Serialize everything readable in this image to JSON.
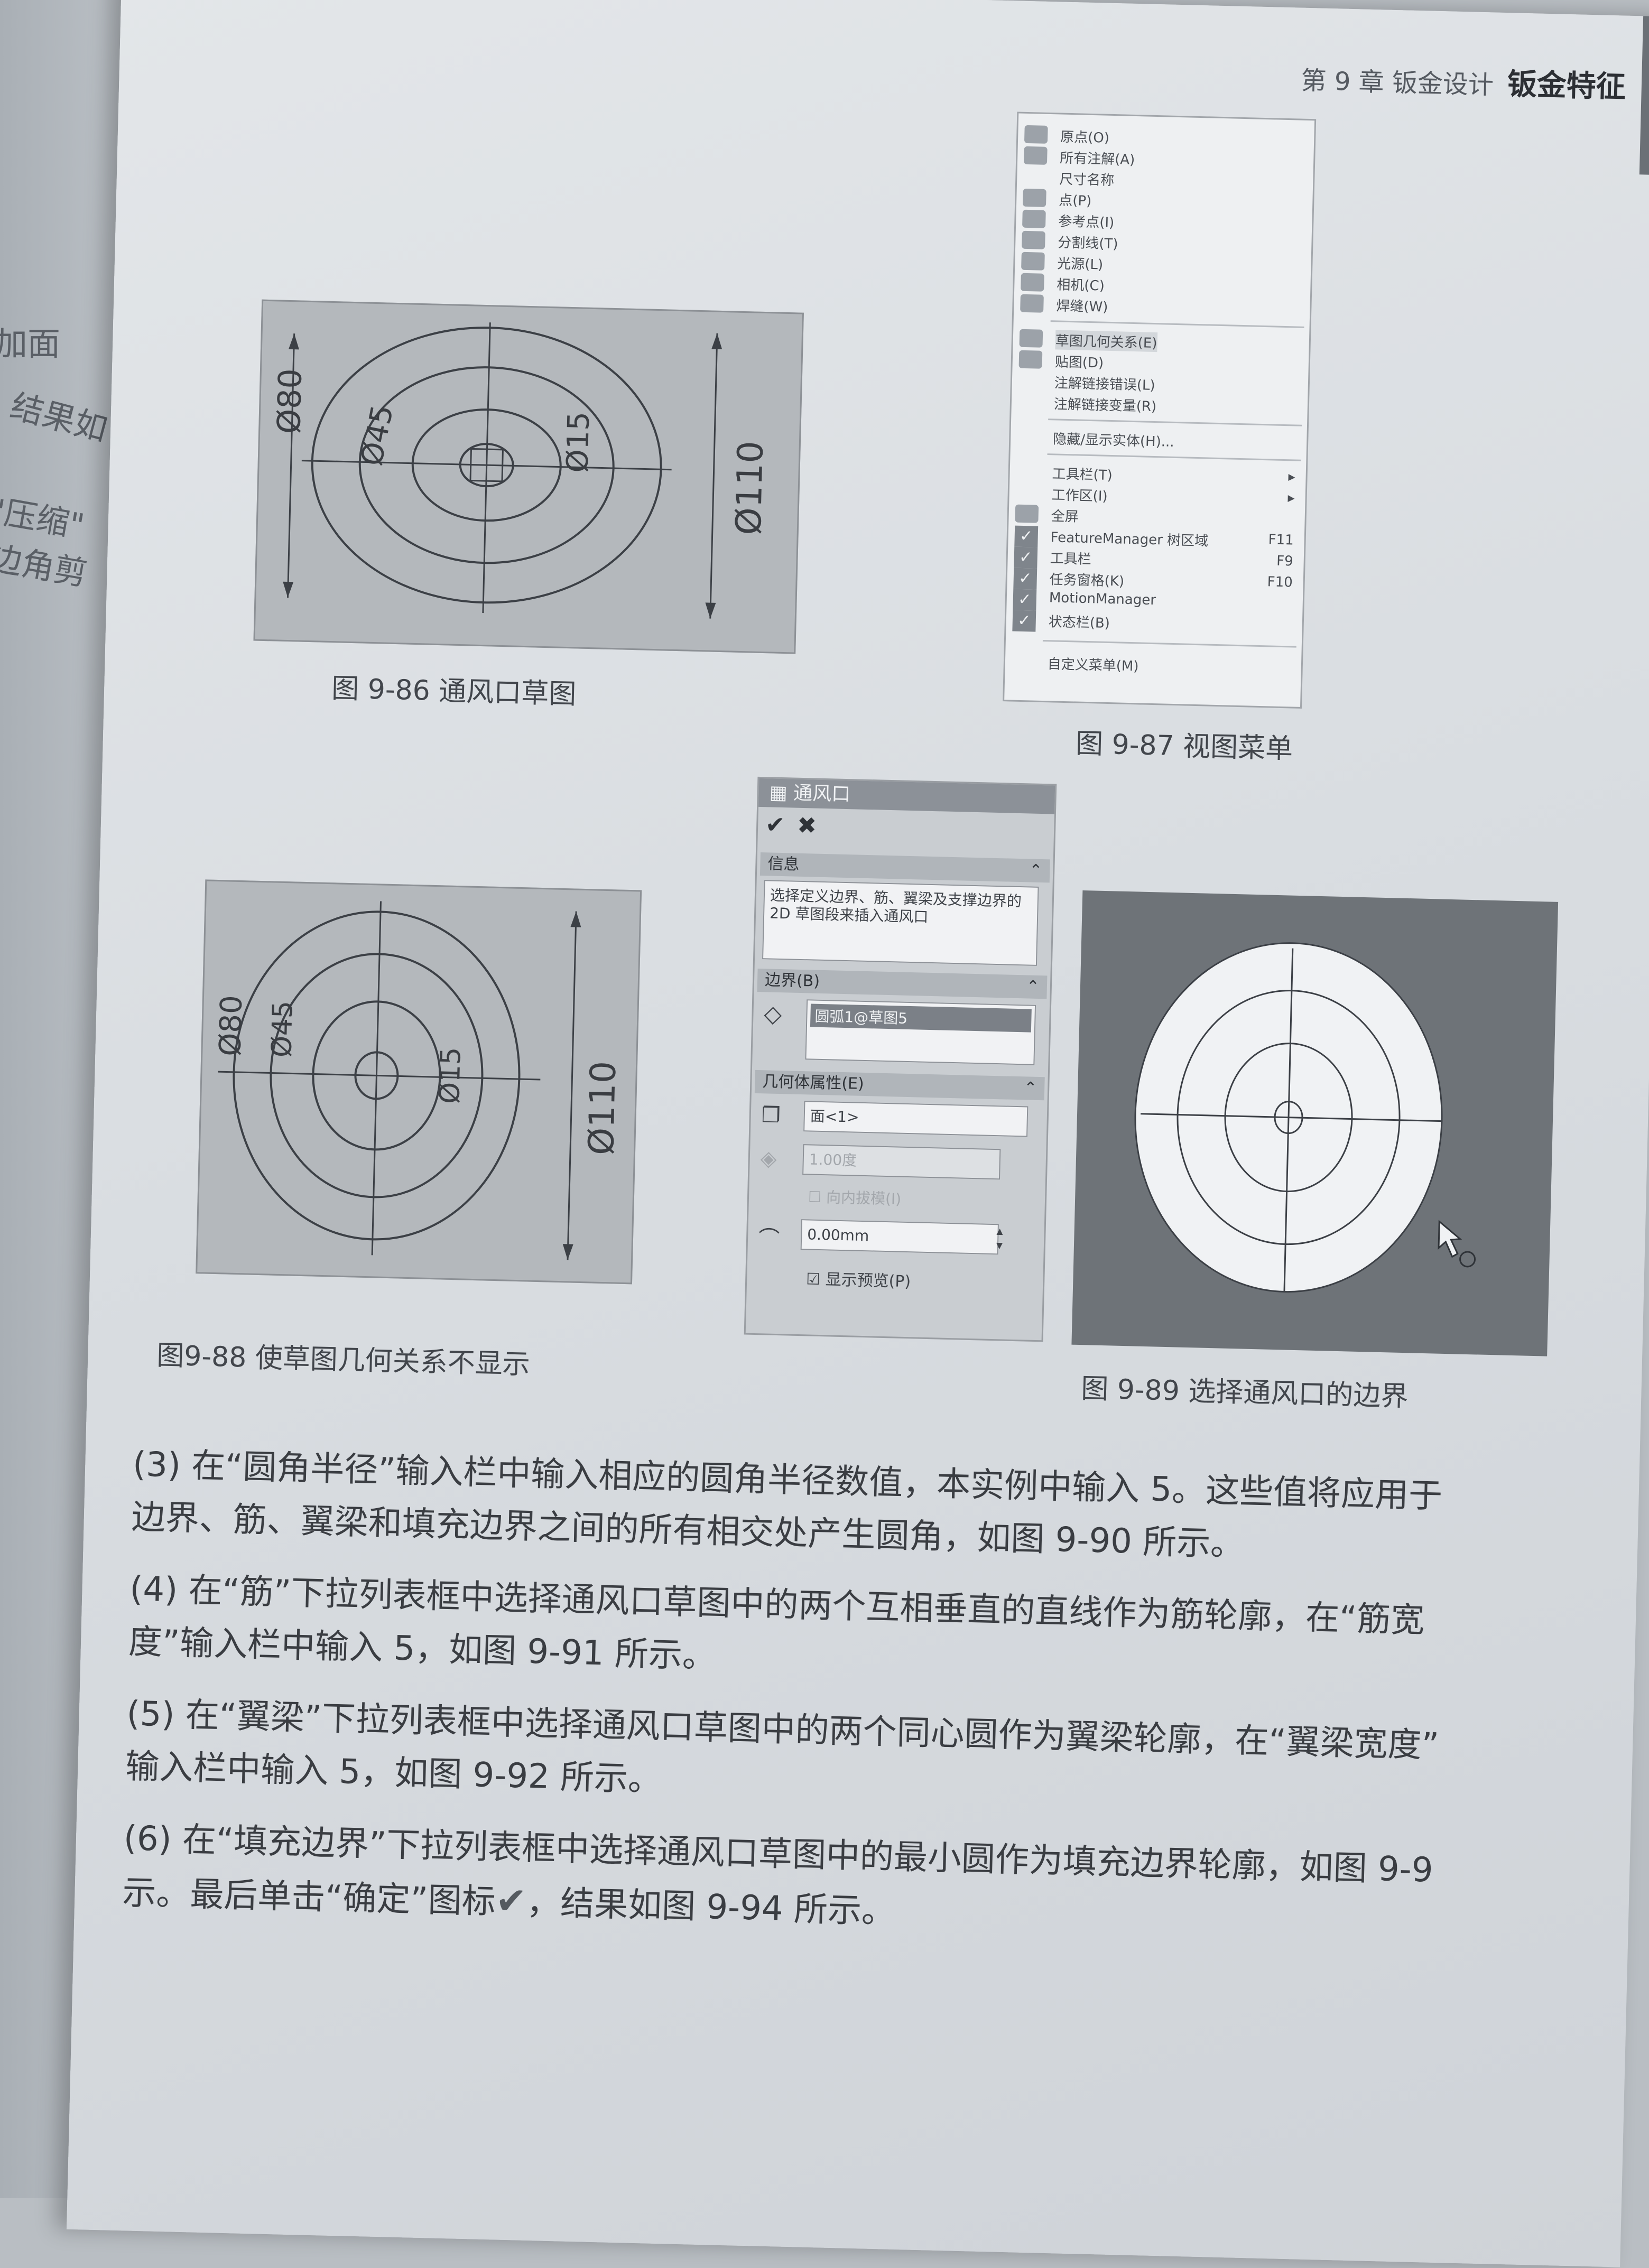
{
  "left_page": {
    "fragments": [
      "加面",
      "结果如",
      "\"压缩\"",
      "边角剪"
    ]
  },
  "header": {
    "chapter": "第 9 章  钣金设计",
    "title": "钣金特征"
  },
  "figures": {
    "fig86": {
      "caption": "图 9-86    通风口草图",
      "dims": {
        "d80": "Ø80",
        "d45": "Ø45",
        "d15": "Ø15",
        "d110": "Ø110"
      }
    },
    "fig87": {
      "caption": "图 9-87    视图菜单",
      "menu_items": [
        "原点(O)",
        "所有注解(A)",
        "尺寸名称",
        "点(P)",
        "参考点(I)",
        "分割线(T)",
        "光源(L)",
        "相机(C)",
        "焊缝(W)",
        "草图几何关系(E)",
        "贴图(D)",
        "注解链接错误(L)",
        "注解链接变量(R)",
        "隐藏/显示实体(H)...",
        "工具栏(T)",
        "工作区(I)",
        "全屏",
        "FeatureManager 树区域",
        "工具栏",
        "任务窗格(K)",
        "MotionManager",
        "状态栏(B)",
        "自定义菜单(M)"
      ],
      "shortcuts": [
        "F11",
        "F9",
        "F10"
      ]
    },
    "fig88": {
      "caption": "图9-88    使草图几何关系不显示",
      "dims": {
        "d80": "Ø80",
        "d45": "Ø45",
        "d15": "Ø15",
        "d110": "Ø110"
      }
    },
    "fig89": {
      "caption": "图 9-89    选择通风口的边界",
      "panel": {
        "title": "通风口",
        "info_heading": "信息",
        "info_text": "选择定义边界、筋、翼梁及支撑边界的 2D 草图段来插入通风口",
        "boundary_heading": "边界(B)",
        "boundary_item": "圆弧1@草图5",
        "geometry_heading": "几何体属性(E)",
        "face_value": "面<1>",
        "draft_value": "1.00度",
        "draft_option": "向内拔模(I)",
        "radius_value": "0.00mm",
        "preview_label": "显示预览(P)"
      }
    }
  },
  "body_paragraphs": [
    "(3) 在“圆角半径”输入栏中输入相应的圆角半径数值，本实例中输入 5。这些值将应用于",
    "边界、筋、翼梁和填充边界之间的所有相交处产生圆角，如图 9-90 所示。",
    "(4) 在“筋”下拉列表框中选择通风口草图中的两个互相垂直的直线作为筋轮廓，在“筋宽",
    "度”输入栏中输入 5，如图 9-91 所示。",
    "(5) 在“翼梁”下拉列表框中选择通风口草图中的两个同心圆作为翼梁轮廓，在“翼梁宽度”",
    "输入栏中输入 5，如图 9-92 所示。",
    "(6) 在“填充边界”下拉列表框中选择通风口草图中的最小圆作为填充边界轮廓，如图 9-9",
    "示。最后单击“确定”图标",
    "，结果如图 9-94 所示。"
  ]
}
